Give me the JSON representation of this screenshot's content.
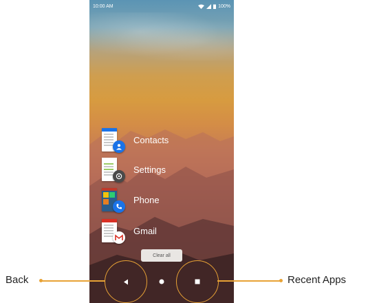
{
  "status_bar": {
    "time": "10:00 AM",
    "battery": "100%"
  },
  "recent_apps": [
    {
      "label": "Contacts",
      "badge_icon": "person-icon",
      "badge_color": "#1a73e8"
    },
    {
      "label": "Settings",
      "badge_icon": "gear-icon",
      "badge_color": "#4a4a4a"
    },
    {
      "label": "Phone",
      "badge_icon": "phone-icon",
      "badge_color": "#1a73e8"
    },
    {
      "label": "Gmail",
      "badge_icon": "mail-icon",
      "badge_color": "#ffffff"
    }
  ],
  "clear_all_label": "Clear all",
  "nav": {
    "back_icon": "triangle-left-icon",
    "home_icon": "circle-icon",
    "recents_icon": "square-icon"
  },
  "annotations": {
    "back_label": "Back",
    "recent_label": "Recent Apps",
    "accent": "#e8a235"
  }
}
